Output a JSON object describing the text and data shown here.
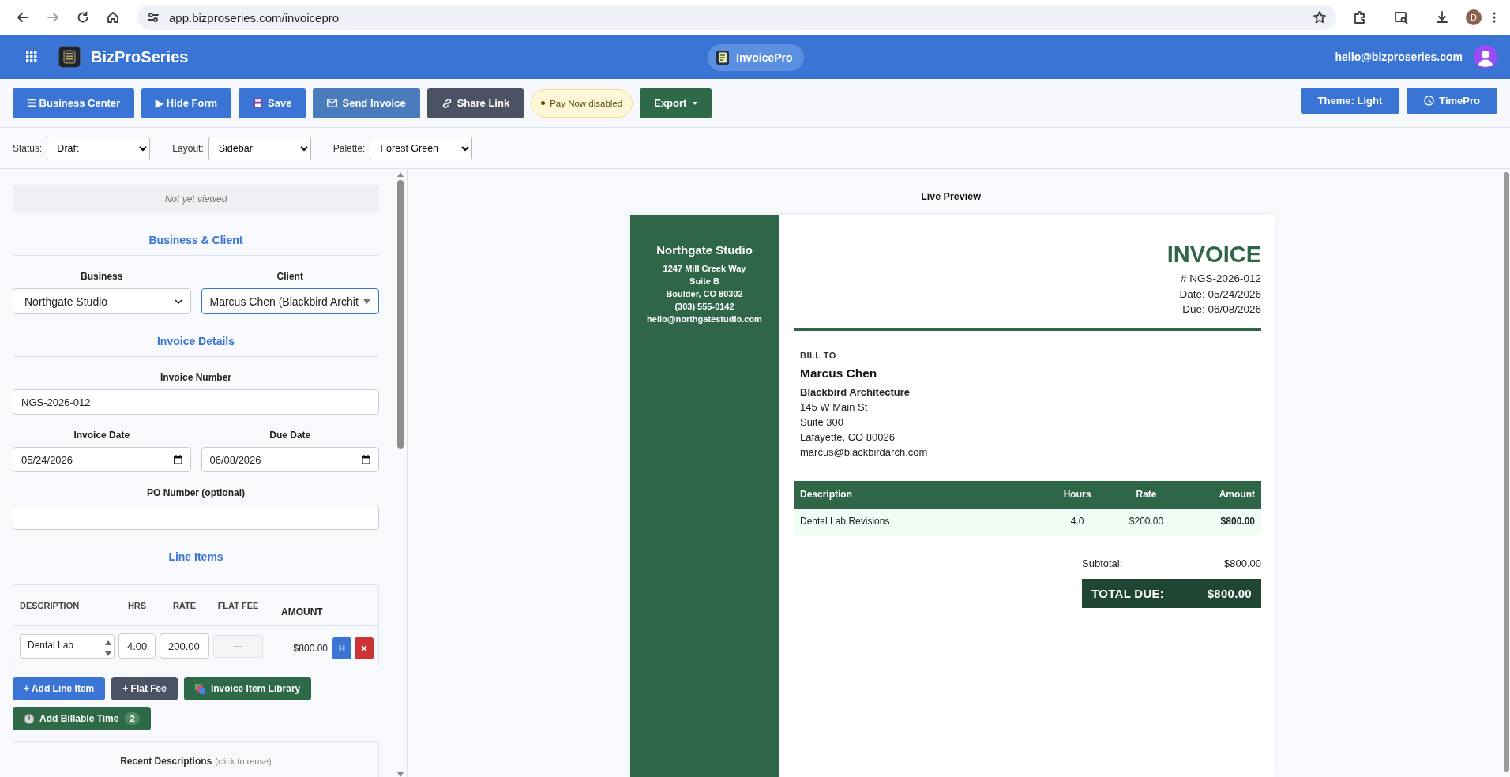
{
  "browser": {
    "url": "app.bizproseries.com/invoicepro",
    "profile_initial": "D"
  },
  "header": {
    "brand": "BizProSeries",
    "app_badge": "InvoicePro",
    "email": "hello@bizproseries.com"
  },
  "toolbar": {
    "buttons": [
      {
        "label": "☰ Business Center",
        "kind": "primary"
      },
      {
        "label": "▶ Hide Form",
        "kind": "primary"
      },
      {
        "label": "Save",
        "kind": "save"
      },
      {
        "label": "Send Invoice",
        "kind": "send"
      },
      {
        "label": "Share Link",
        "kind": "share"
      },
      {
        "label": "Pay Now disabled",
        "kind": "notice"
      },
      {
        "label": "Export",
        "kind": "export"
      }
    ],
    "right_buttons": [
      {
        "label": "Theme: Light",
        "kind": "primary"
      },
      {
        "label": "TimePro",
        "kind": "clock"
      }
    ]
  },
  "filters": [
    {
      "label": "Status:",
      "value": "Draft"
    },
    {
      "label": "Layout:",
      "value": "Sidebar"
    },
    {
      "label": "Palette:",
      "value": "Forest Green"
    }
  ],
  "form": {
    "view_status": "Not yet viewed",
    "business_client": {
      "heading": "Business & Client",
      "business": {
        "label": "Business",
        "value": "Northgate Studio",
        "focused": false
      },
      "client": {
        "label": "Client",
        "value": "Marcus Chen (Blackbird Archit",
        "focused": true
      }
    },
    "invoice_details": {
      "heading": "Invoice Details",
      "invoice_number": {
        "label": "Invoice Number",
        "value": "NGS-2026-012"
      },
      "invoice_date": {
        "label": "Invoice Date",
        "value": "05/24/2026"
      },
      "due_date": {
        "label": "Due Date",
        "value": "06/08/2026"
      },
      "po_number": {
        "label": "PO Number (optional)"
      }
    },
    "line_items": {
      "heading": "Line Items",
      "columns": [
        "DESCRIPTION",
        "HRS",
        "RATE",
        "FLAT FEE",
        "AMOUNT"
      ],
      "rows": [
        {
          "description": "Dental Lab",
          "hours": "4.00",
          "rate": "200.00",
          "flat_fee": {
            "placeholder": "—",
            "disabled": true
          },
          "amount": "$800.00",
          "hourly_label": "H",
          "remove_label": "×"
        }
      ],
      "buttons": [
        {
          "label": "+ Add Line Item",
          "kind": "primary"
        },
        {
          "label": "+ Flat Fee",
          "kind": "dark"
        },
        {
          "label": "Invoice Item Library",
          "kind": "library"
        },
        {
          "label": "Add Billable Time",
          "kind": "time",
          "badge": "2"
        }
      ]
    },
    "recent": {
      "title": "Recent Descriptions",
      "hint": "(click to reuse)"
    }
  },
  "preview": {
    "title": "Live Preview",
    "invoice": {
      "business": {
        "name": "Northgate Studio",
        "lines": [
          "1247 Mill Creek Way",
          "Suite B",
          "Boulder, CO 80302",
          "(303) 555-0142",
          "hello@northgatestudio.com"
        ]
      },
      "heading": "INVOICE",
      "meta": [
        "# NGS-2026-012",
        "Date: 05/24/2026",
        "Due: 06/08/2026"
      ],
      "bill_to": {
        "label": "BILL TO",
        "name": "Marcus Chen",
        "company": "Blackbird Architecture",
        "lines": [
          "145 W Main St",
          "Suite 300",
          "Lafayette, CO 80026",
          "marcus@blackbirdarch.com"
        ]
      },
      "columns": [
        "Description",
        "Hours",
        "Rate",
        "Amount"
      ],
      "rows": [
        {
          "description": "Dental Lab Revisions",
          "hours": "4.0",
          "rate": "$200.00",
          "amount": "$800.00"
        }
      ],
      "subtotal": {
        "label": "Subtotal:",
        "value": "$800.00"
      },
      "total": {
        "label": "TOTAL DUE:",
        "value": "$800.00"
      }
    }
  }
}
